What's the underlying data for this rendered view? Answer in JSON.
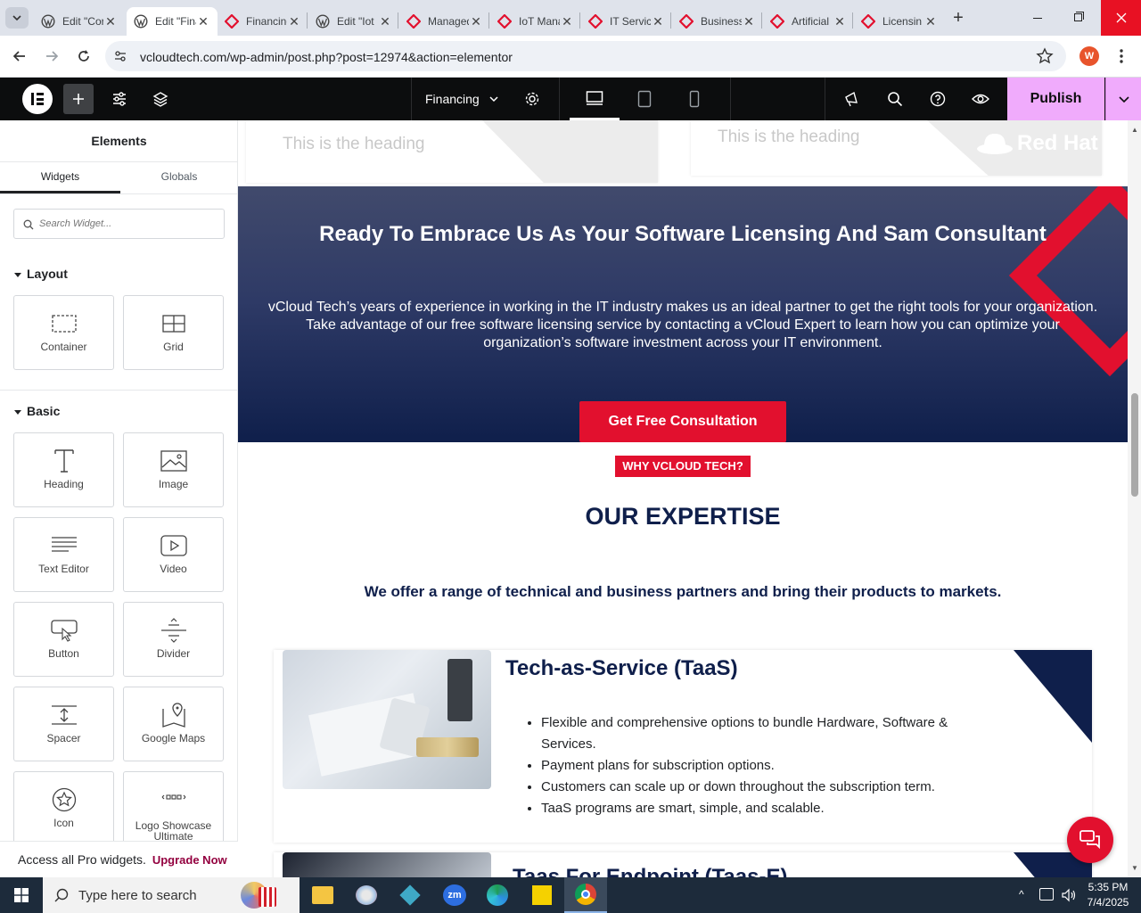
{
  "browser": {
    "tabs": [
      {
        "title": "Edit \"Cor",
        "icon": "wp-icon"
      },
      {
        "title": "Edit \"Fina",
        "icon": "wp-icon",
        "active": true
      },
      {
        "title": "Financing",
        "icon": "vcloud-icon"
      },
      {
        "title": "Edit \"Iot",
        "icon": "wp-icon"
      },
      {
        "title": "Managed",
        "icon": "vcloud-icon"
      },
      {
        "title": "IoT Mana",
        "icon": "vcloud-icon"
      },
      {
        "title": "IT Servic",
        "icon": "vcloud-icon"
      },
      {
        "title": "Business",
        "icon": "vcloud-icon"
      },
      {
        "title": "Artificial",
        "icon": "vcloud-icon"
      },
      {
        "title": "Licensin",
        "icon": "vcloud-icon"
      }
    ],
    "url": "vcloudtech.com/wp-admin/post.php?post=12974&action=elementor",
    "profile_initial": "W"
  },
  "editor": {
    "page_name": "Financing",
    "publish_label": "Publish"
  },
  "panel": {
    "title": "Elements",
    "tabs": [
      "Widgets",
      "Globals"
    ],
    "search_placeholder": "Search Widget...",
    "layout_label": "Layout",
    "basic_label": "Basic",
    "layout_widgets": [
      "Container",
      "Grid"
    ],
    "basic_widgets": [
      "Heading",
      "Image",
      "Text Editor",
      "Video",
      "Button",
      "Divider",
      "Spacer",
      "Google Maps",
      "Icon",
      "Logo Showcase Ultimate"
    ],
    "promo_text": "Access all Pro widgets.",
    "promo_link": "Upgrade Now"
  },
  "canvas": {
    "top_card_heading_1": "This is the heading",
    "top_card_heading_2": "This is the heading",
    "redhat_logo": "Red Hat",
    "cta": {
      "heading": "Ready To Embrace Us As Your Software Licensing And Sam Consultant",
      "body": "vCloud Tech’s years of experience in working in the IT industry makes us an ideal partner to get the right tools for your organization. Take advantage of our free software licensing service by contacting a vCloud Expert to learn how you can optimize your organization’s software investment across your IT environment.",
      "button": "Get Free Consultation"
    },
    "why_badge": "WHY VCLOUD TECH?",
    "expertise_title": "OUR EXPERTISE",
    "expertise_sub": "We offer a range of technical and business partners and bring their products to markets.",
    "card1": {
      "title": "Tech-as-Service (TaaS)",
      "bullets": [
        "Flexible and comprehensive options to bundle Hardware, Software & Services.",
        "Payment plans for subscription options.",
        "Customers can scale up or down throughout the subscription term.",
        "TaaS programs are smart, simple, and scalable."
      ]
    },
    "card2_title": "Taas For Endpoint (Taas-E)"
  },
  "taskbar": {
    "search_placeholder": "Type here to search",
    "time": "5:35 PM",
    "date": "7/4/2025"
  },
  "colors": {
    "accent_red": "#e2102e",
    "navy": "#0f1f4b",
    "publish_bg": "#f0abfc"
  }
}
